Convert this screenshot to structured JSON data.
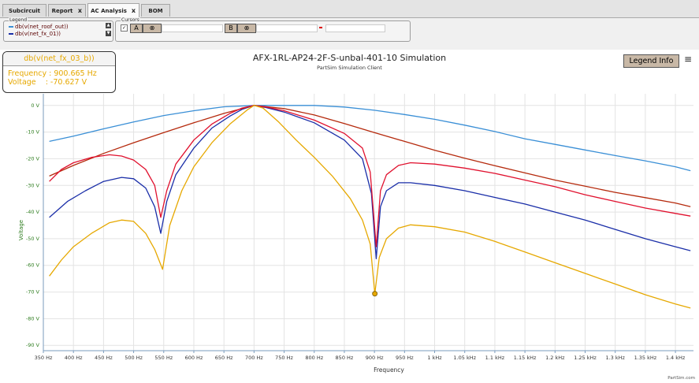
{
  "tabs": [
    {
      "label": "Subcircuit",
      "active": false,
      "closable": false
    },
    {
      "label": "Report",
      "active": false,
      "closable": true
    },
    {
      "label": "AC Analysis",
      "active": true,
      "closable": true
    },
    {
      "label": "BOM",
      "active": false,
      "closable": false
    }
  ],
  "tab_close_glyph": "x",
  "legend_panel": {
    "title": "Legend",
    "items": [
      {
        "label": "db(v(net_roof_out))",
        "color": "#3a8fd6"
      },
      {
        "label": "db(v(net_fx_01))",
        "color": "#1a2ea8"
      }
    ]
  },
  "cursors_panel": {
    "title": "Cursors",
    "checkbox": "✓",
    "cursor_a_label": "A",
    "cursor_b_label": "B",
    "target_glyph": "⊗"
  },
  "readout": {
    "series": "db(v(net_fx_03_b))",
    "frequency_line": "Frequency : 900.665 Hz",
    "voltage_line": "Voltage    : -70.627 V",
    "color": "#e6a800"
  },
  "legend_info_button": "Legend Info",
  "menu_icon": "≡",
  "brand": "PartSim.com",
  "chart_data": {
    "type": "line",
    "title": "AFX-1RL-AP24-2F-S-unbal-401-10 Simulation",
    "subtitle": "PartSim Simulation Client",
    "xlabel": "Frequency",
    "ylabel": "Voltage",
    "xlim": [
      350,
      1430
    ],
    "ylim": [
      -92,
      2
    ],
    "x_ticks": [
      {
        "v": 350,
        "label": "350 Hz"
      },
      {
        "v": 400,
        "label": "400 Hz"
      },
      {
        "v": 450,
        "label": "450 Hz"
      },
      {
        "v": 500,
        "label": "500 Hz"
      },
      {
        "v": 550,
        "label": "550 Hz"
      },
      {
        "v": 600,
        "label": "600 Hz"
      },
      {
        "v": 650,
        "label": "650 Hz"
      },
      {
        "v": 700,
        "label": "700 Hz"
      },
      {
        "v": 750,
        "label": "750 Hz"
      },
      {
        "v": 800,
        "label": "800 Hz"
      },
      {
        "v": 850,
        "label": "850 Hz"
      },
      {
        "v": 900,
        "label": "900 Hz"
      },
      {
        "v": 950,
        "label": "950 Hz"
      },
      {
        "v": 1000,
        "label": "1 kHz"
      },
      {
        "v": 1050,
        "label": "1.05 kHz"
      },
      {
        "v": 1100,
        "label": "1.1 kHz"
      },
      {
        "v": 1150,
        "label": "1.15 kHz"
      },
      {
        "v": 1200,
        "label": "1.2 kHz"
      },
      {
        "v": 1250,
        "label": "1.25 kHz"
      },
      {
        "v": 1300,
        "label": "1.3 kHz"
      },
      {
        "v": 1350,
        "label": "1.35 kHz"
      },
      {
        "v": 1400,
        "label": "1.4 kHz"
      }
    ],
    "y_ticks": [
      {
        "v": 0,
        "label": "0 V"
      },
      {
        "v": -10,
        "label": "-10 V"
      },
      {
        "v": -20,
        "label": "-20 V"
      },
      {
        "v": -30,
        "label": "-30 V"
      },
      {
        "v": -40,
        "label": "-40 V"
      },
      {
        "v": -50,
        "label": "-50 V"
      },
      {
        "v": -60,
        "label": "-60 V"
      },
      {
        "v": -70,
        "label": "-70 V"
      },
      {
        "v": -80,
        "label": "-80 V"
      },
      {
        "v": -90,
        "label": "-90 V"
      }
    ],
    "grid": true,
    "series": [
      {
        "name": "db(v(net_roof_out))",
        "color": "#3a8fd6",
        "points": [
          [
            360,
            -13.5
          ],
          [
            400,
            -11.5
          ],
          [
            450,
            -8.8
          ],
          [
            500,
            -6.2
          ],
          [
            550,
            -3.8
          ],
          [
            600,
            -2
          ],
          [
            650,
            -0.5
          ],
          [
            700,
            0
          ],
          [
            750,
            0
          ],
          [
            800,
            0
          ],
          [
            850,
            -0.6
          ],
          [
            900,
            -1.8
          ],
          [
            950,
            -3.4
          ],
          [
            1000,
            -5.2
          ],
          [
            1050,
            -7.4
          ],
          [
            1100,
            -9.8
          ],
          [
            1150,
            -12.5
          ],
          [
            1200,
            -14.6
          ],
          [
            1250,
            -16.7
          ],
          [
            1300,
            -18.8
          ],
          [
            1350,
            -20.8
          ],
          [
            1400,
            -23
          ],
          [
            1425,
            -24.5
          ]
        ]
      },
      {
        "name": "db(v(net_fx_01))",
        "color": "#1a2ea8",
        "points": [
          [
            360,
            -42
          ],
          [
            390,
            -36
          ],
          [
            420,
            -32
          ],
          [
            450,
            -28.5
          ],
          [
            480,
            -27
          ],
          [
            500,
            -27.5
          ],
          [
            520,
            -31
          ],
          [
            535,
            -38
          ],
          [
            545,
            -48
          ],
          [
            555,
            -36
          ],
          [
            570,
            -26
          ],
          [
            600,
            -16
          ],
          [
            630,
            -8.5
          ],
          [
            660,
            -4
          ],
          [
            680,
            -1.5
          ],
          [
            700,
            0
          ],
          [
            720,
            -0.8
          ],
          [
            750,
            -2.5
          ],
          [
            800,
            -6.5
          ],
          [
            850,
            -13
          ],
          [
            880,
            -20
          ],
          [
            895,
            -33
          ],
          [
            903,
            -57.5
          ],
          [
            910,
            -38
          ],
          [
            920,
            -32
          ],
          [
            940,
            -29
          ],
          [
            960,
            -29
          ],
          [
            1000,
            -30
          ],
          [
            1050,
            -32
          ],
          [
            1100,
            -34.5
          ],
          [
            1150,
            -37
          ],
          [
            1200,
            -40
          ],
          [
            1250,
            -43
          ],
          [
            1300,
            -46.5
          ],
          [
            1350,
            -50
          ],
          [
            1400,
            -53
          ],
          [
            1425,
            -54.5
          ]
        ]
      },
      {
        "name": "",
        "color": "#b52a0d",
        "points": [
          [
            360,
            -26.5
          ],
          [
            400,
            -22.5
          ],
          [
            450,
            -18
          ],
          [
            500,
            -14
          ],
          [
            550,
            -10.2
          ],
          [
            600,
            -6.5
          ],
          [
            650,
            -3
          ],
          [
            700,
            0
          ],
          [
            750,
            -1.2
          ],
          [
            800,
            -3.6
          ],
          [
            850,
            -6.8
          ],
          [
            900,
            -10.2
          ],
          [
            950,
            -13.5
          ],
          [
            1000,
            -16.8
          ],
          [
            1050,
            -19.8
          ],
          [
            1100,
            -22.6
          ],
          [
            1150,
            -25.3
          ],
          [
            1200,
            -28
          ],
          [
            1250,
            -30.3
          ],
          [
            1300,
            -32.6
          ],
          [
            1350,
            -34.6
          ],
          [
            1400,
            -36.6
          ],
          [
            1425,
            -38
          ]
        ]
      },
      {
        "name": "",
        "color": "#e0112e",
        "points": [
          [
            360,
            -28.5
          ],
          [
            380,
            -24
          ],
          [
            400,
            -21.5
          ],
          [
            430,
            -19.5
          ],
          [
            460,
            -18.5
          ],
          [
            480,
            -19
          ],
          [
            500,
            -20.5
          ],
          [
            520,
            -24
          ],
          [
            535,
            -30
          ],
          [
            545,
            -42
          ],
          [
            555,
            -32
          ],
          [
            570,
            -22
          ],
          [
            600,
            -13
          ],
          [
            630,
            -7
          ],
          [
            660,
            -3
          ],
          [
            680,
            -1
          ],
          [
            700,
            0
          ],
          [
            720,
            -0.6
          ],
          [
            750,
            -2
          ],
          [
            800,
            -5.5
          ],
          [
            850,
            -10.5
          ],
          [
            880,
            -16
          ],
          [
            893,
            -25
          ],
          [
            903,
            -53
          ],
          [
            910,
            -32
          ],
          [
            920,
            -26
          ],
          [
            940,
            -22.5
          ],
          [
            960,
            -21.5
          ],
          [
            1000,
            -22
          ],
          [
            1050,
            -23.5
          ],
          [
            1100,
            -25.5
          ],
          [
            1150,
            -28
          ],
          [
            1200,
            -30.5
          ],
          [
            1250,
            -33.5
          ],
          [
            1300,
            -36
          ],
          [
            1350,
            -38.5
          ],
          [
            1400,
            -40.5
          ],
          [
            1425,
            -41.5
          ]
        ]
      },
      {
        "name": "db(v(net_fx_03_b))",
        "color": "#e6a800",
        "points": [
          [
            360,
            -64
          ],
          [
            380,
            -58
          ],
          [
            400,
            -53
          ],
          [
            430,
            -48
          ],
          [
            460,
            -44
          ],
          [
            480,
            -43
          ],
          [
            500,
            -43.5
          ],
          [
            520,
            -48
          ],
          [
            535,
            -54
          ],
          [
            548,
            -61.5
          ],
          [
            560,
            -45
          ],
          [
            580,
            -32
          ],
          [
            600,
            -23
          ],
          [
            630,
            -14
          ],
          [
            660,
            -7
          ],
          [
            690,
            -1.5
          ],
          [
            700,
            0
          ],
          [
            715,
            -1
          ],
          [
            740,
            -6
          ],
          [
            770,
            -13
          ],
          [
            800,
            -19.5
          ],
          [
            830,
            -26.5
          ],
          [
            860,
            -35
          ],
          [
            880,
            -43
          ],
          [
            893,
            -52
          ],
          [
            900.665,
            -70.627
          ],
          [
            908,
            -57
          ],
          [
            920,
            -50
          ],
          [
            940,
            -46
          ],
          [
            960,
            -44.8
          ],
          [
            1000,
            -45.5
          ],
          [
            1050,
            -47.5
          ],
          [
            1100,
            -51
          ],
          [
            1150,
            -55
          ],
          [
            1200,
            -59
          ],
          [
            1250,
            -63
          ],
          [
            1300,
            -67
          ],
          [
            1350,
            -71
          ],
          [
            1400,
            -74.5
          ],
          [
            1425,
            -76
          ]
        ]
      }
    ],
    "marker": {
      "x": 900.665,
      "y": -70.627,
      "color": "#e6a800"
    }
  }
}
